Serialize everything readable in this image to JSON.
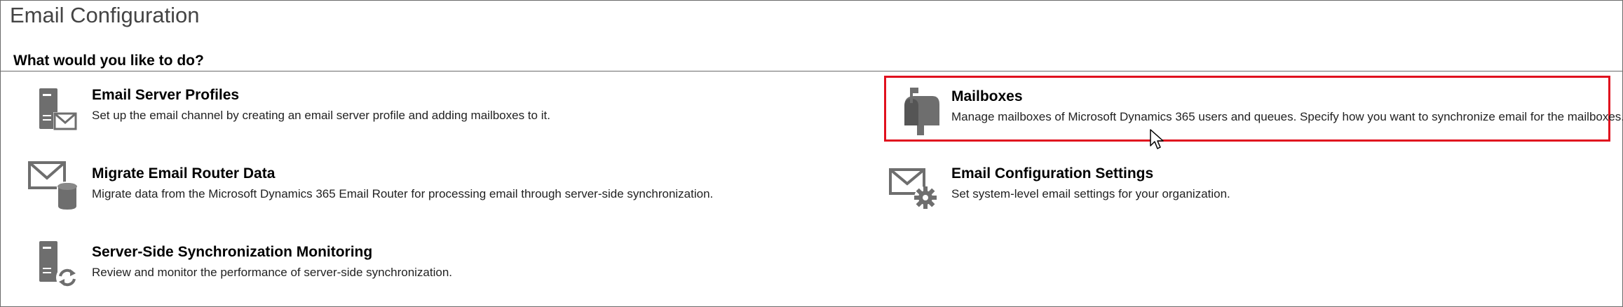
{
  "page": {
    "title": "Email Configuration",
    "section_heading": "What would you like to do?"
  },
  "items": [
    {
      "id": "email-server-profiles",
      "title": "Email Server Profiles",
      "description": "Set up the email channel by creating an email server profile and adding mailboxes to it.",
      "icon": "server-envelope-icon"
    },
    {
      "id": "mailboxes",
      "title": "Mailboxes",
      "description": "Manage mailboxes of Microsoft Dynamics 365 users and queues. Specify how you want to synchronize email for the mailboxes.",
      "icon": "mailbox-icon",
      "highlighted": true,
      "highlight_color": "#e0101e"
    },
    {
      "id": "migrate-email-router-data",
      "title": "Migrate Email Router Data",
      "description": "Migrate data from the Microsoft Dynamics 365 Email Router for processing email through server-side synchronization.",
      "icon": "envelope-database-icon"
    },
    {
      "id": "email-configuration-settings",
      "title": "Email Configuration Settings",
      "description": "Set system-level email settings for your organization.",
      "icon": "envelope-gear-icon"
    },
    {
      "id": "server-side-synchronization-monitoring",
      "title": "Server-Side Synchronization Monitoring",
      "description": "Review and monitor the performance of server-side synchronization.",
      "icon": "server-sync-icon"
    }
  ],
  "colors": {
    "icon_gray": "#6e6e6e",
    "highlight": "#e0101e",
    "title_gray": "#444444"
  }
}
